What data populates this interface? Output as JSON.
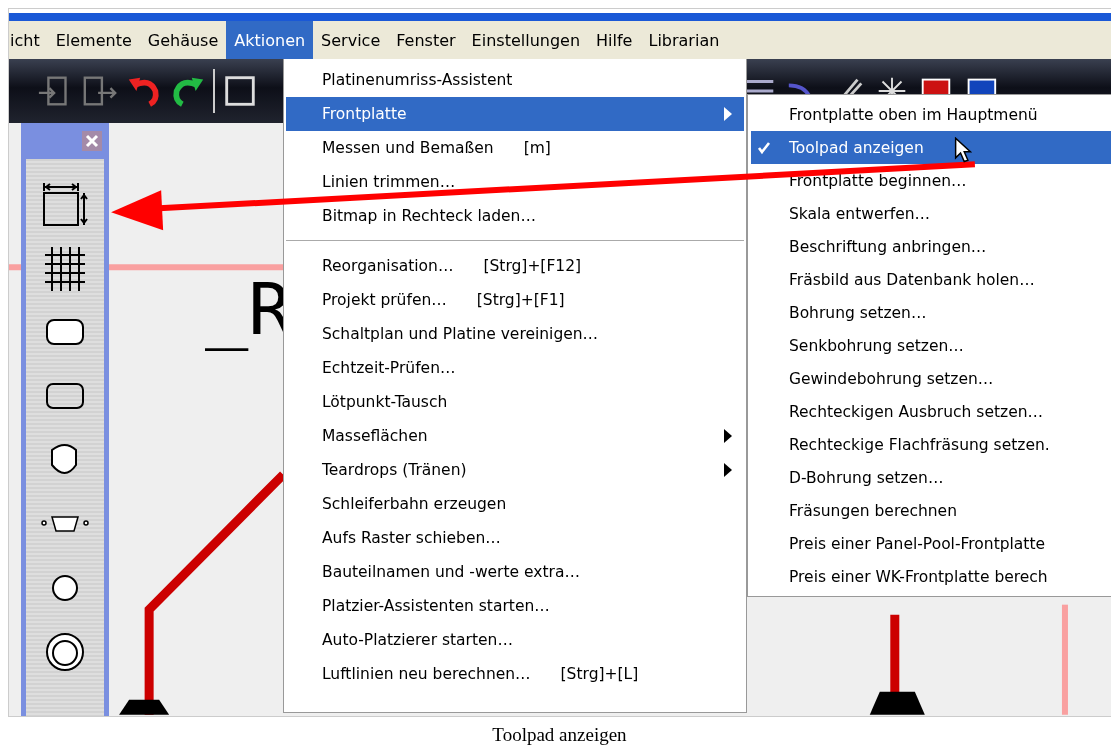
{
  "menubar": {
    "items": [
      {
        "label": "icht",
        "selected": false
      },
      {
        "label": "Elemente",
        "selected": false
      },
      {
        "label": "Gehäuse",
        "selected": false
      },
      {
        "label": "Aktionen",
        "selected": true
      },
      {
        "label": "Service",
        "selected": false
      },
      {
        "label": "Fenster",
        "selected": false
      },
      {
        "label": "Einstellungen",
        "selected": false
      },
      {
        "label": "Hilfe",
        "selected": false
      },
      {
        "label": "Librarian",
        "selected": false
      }
    ]
  },
  "canvas": {
    "label": "_R"
  },
  "menu": {
    "items": [
      {
        "kind": "item",
        "label": "Platinenumriss-Assistent",
        "has_submenu": false,
        "selected": false
      },
      {
        "kind": "item",
        "label": "Frontplatte",
        "has_submenu": true,
        "selected": true
      },
      {
        "kind": "item",
        "label": "Messen und Bemaßen",
        "shortcut": "[m]",
        "has_submenu": false,
        "selected": false
      },
      {
        "kind": "item",
        "label": "Linien trimmen…",
        "has_submenu": false,
        "selected": false
      },
      {
        "kind": "item",
        "label": "Bitmap in Rechteck laden…",
        "has_submenu": false,
        "selected": false
      },
      {
        "kind": "separator"
      },
      {
        "kind": "item",
        "label": "Reorganisation…",
        "shortcut": "[Strg]+[F12]",
        "has_submenu": false,
        "selected": false
      },
      {
        "kind": "item",
        "label": "Projekt prüfen…",
        "shortcut": "[Strg]+[F1]",
        "has_submenu": false,
        "selected": false
      },
      {
        "kind": "item",
        "label": "Schaltplan und Platine vereinigen…",
        "has_submenu": false,
        "selected": false
      },
      {
        "kind": "item",
        "label": "Echtzeit-Prüfen…",
        "has_submenu": false,
        "selected": false
      },
      {
        "kind": "item",
        "label": "Lötpunkt-Tausch",
        "has_submenu": false,
        "selected": false
      },
      {
        "kind": "item",
        "label": "Masseflächen",
        "has_submenu": true,
        "selected": false
      },
      {
        "kind": "item",
        "label": "Teardrops (Tränen)",
        "has_submenu": true,
        "selected": false
      },
      {
        "kind": "item",
        "label": "Schleiferbahn erzeugen",
        "has_submenu": false,
        "selected": false
      },
      {
        "kind": "item",
        "label": "Aufs Raster schieben…",
        "has_submenu": false,
        "selected": false
      },
      {
        "kind": "item",
        "label": "Bauteilnamen und -werte extra…",
        "has_submenu": false,
        "selected": false
      },
      {
        "kind": "item",
        "label": "Platzier-Assistenten starten…",
        "has_submenu": false,
        "selected": false
      },
      {
        "kind": "item",
        "label": "Auto-Platzierer starten…",
        "has_submenu": false,
        "selected": false
      },
      {
        "kind": "item",
        "label": "Luftlinien neu berechnen…",
        "shortcut": "[Strg]+[L]",
        "has_submenu": false,
        "selected": false
      }
    ]
  },
  "submenu": {
    "items": [
      {
        "label": "Frontplatte oben im Hauptmenü",
        "checked": false,
        "selected": false
      },
      {
        "label": "Toolpad anzeigen",
        "checked": true,
        "selected": true
      },
      {
        "label": "Frontplatte beginnen…",
        "checked": false,
        "selected": false
      },
      {
        "label": "Skala entwerfen…",
        "checked": false,
        "selected": false
      },
      {
        "label": "Beschriftung anbringen…",
        "checked": false,
        "selected": false
      },
      {
        "label": "Fräsbild aus Datenbank holen…",
        "checked": false,
        "selected": false
      },
      {
        "label": "Bohrung setzen…",
        "checked": false,
        "selected": false
      },
      {
        "label": "Senkbohrung setzen…",
        "checked": false,
        "selected": false
      },
      {
        "label": "Gewindebohrung setzen…",
        "checked": false,
        "selected": false
      },
      {
        "label": "Rechteckigen Ausbruch setzen…",
        "checked": false,
        "selected": false
      },
      {
        "label": "Rechteckige Flachfräsung setzen.",
        "checked": false,
        "selected": false
      },
      {
        "label": "D-Bohrung setzen…",
        "checked": false,
        "selected": false
      },
      {
        "label": "Fräsungen berechnen",
        "checked": false,
        "selected": false
      },
      {
        "label": "Preis einer Panel-Pool-Frontplatte",
        "checked": false,
        "selected": false
      },
      {
        "label": "Preis einer WK-Frontplatte berech",
        "checked": false,
        "selected": false
      }
    ]
  },
  "caption": "Toolpad anzeigen"
}
